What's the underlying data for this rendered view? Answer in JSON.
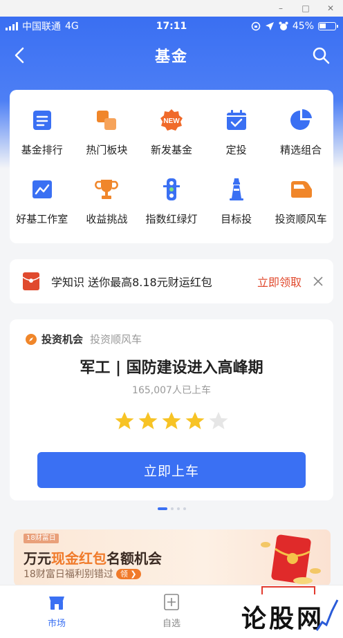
{
  "window": {
    "minimize": "–",
    "restore": "□",
    "close": "✕"
  },
  "status_bar": {
    "carrier": "中国联通",
    "network": "4G",
    "time": "17:11",
    "battery": "45%",
    "battery_level": 0.45
  },
  "nav": {
    "title": "基金",
    "back_icon": "back-arrow-icon",
    "search_icon": "search-icon"
  },
  "grid": {
    "items": [
      {
        "label": "基金排行",
        "icon": "ranking-list-icon",
        "color": "#3a70f3"
      },
      {
        "label": "热门板块",
        "icon": "blocks-icon",
        "color": "#f0862a"
      },
      {
        "label": "新发基金",
        "icon": "new-badge-icon",
        "color": "#f06a2a",
        "badge": "NEW"
      },
      {
        "label": "定投",
        "icon": "calendar-check-icon",
        "color": "#3a70f3"
      },
      {
        "label": "精选组合",
        "icon": "pie-chart-icon",
        "color": "#3a70f3"
      },
      {
        "label": "好基工作室",
        "icon": "trend-chart-icon",
        "color": "#3a70f3"
      },
      {
        "label": "收益挑战",
        "icon": "trophy-icon",
        "color": "#f0862a"
      },
      {
        "label": "指数红绿灯",
        "icon": "traffic-light-icon",
        "color": "#3a70f3"
      },
      {
        "label": "目标投",
        "icon": "lighthouse-icon",
        "color": "#3a70f3"
      },
      {
        "label": "投资顺风车",
        "icon": "car-icon",
        "color": "#f0862a"
      }
    ]
  },
  "promo": {
    "text": "学知识 送你最高8.18元财运红包",
    "cta": "立即领取",
    "icon": "red-envelope-icon",
    "close_icon": "close-icon"
  },
  "opportunity": {
    "head_title": "投资机会",
    "head_sub": "投资顺风车",
    "title": "军工 | 国防建设进入高峰期",
    "count": "165,007人已上车",
    "rating": 4,
    "rating_max": 5,
    "button": "立即上车"
  },
  "pager": {
    "total": 4,
    "active": 0
  },
  "banner": {
    "tag": "18财富日",
    "title_pre": "万元",
    "title_hl": "现金红包",
    "title_post": "名额机会",
    "subtitle": "18财富日福利别错过",
    "pill": "领 ❯"
  },
  "tabbar": {
    "tabs": [
      {
        "label": "市场",
        "icon": "market-icon",
        "active": true
      },
      {
        "label": "自选",
        "icon": "add-watchlist-icon",
        "active": false
      }
    ]
  },
  "watermark": {
    "text": "论股网"
  },
  "colors": {
    "primary": "#3a70f3",
    "accent_red": "#e0482c",
    "star": "#f7c325"
  }
}
